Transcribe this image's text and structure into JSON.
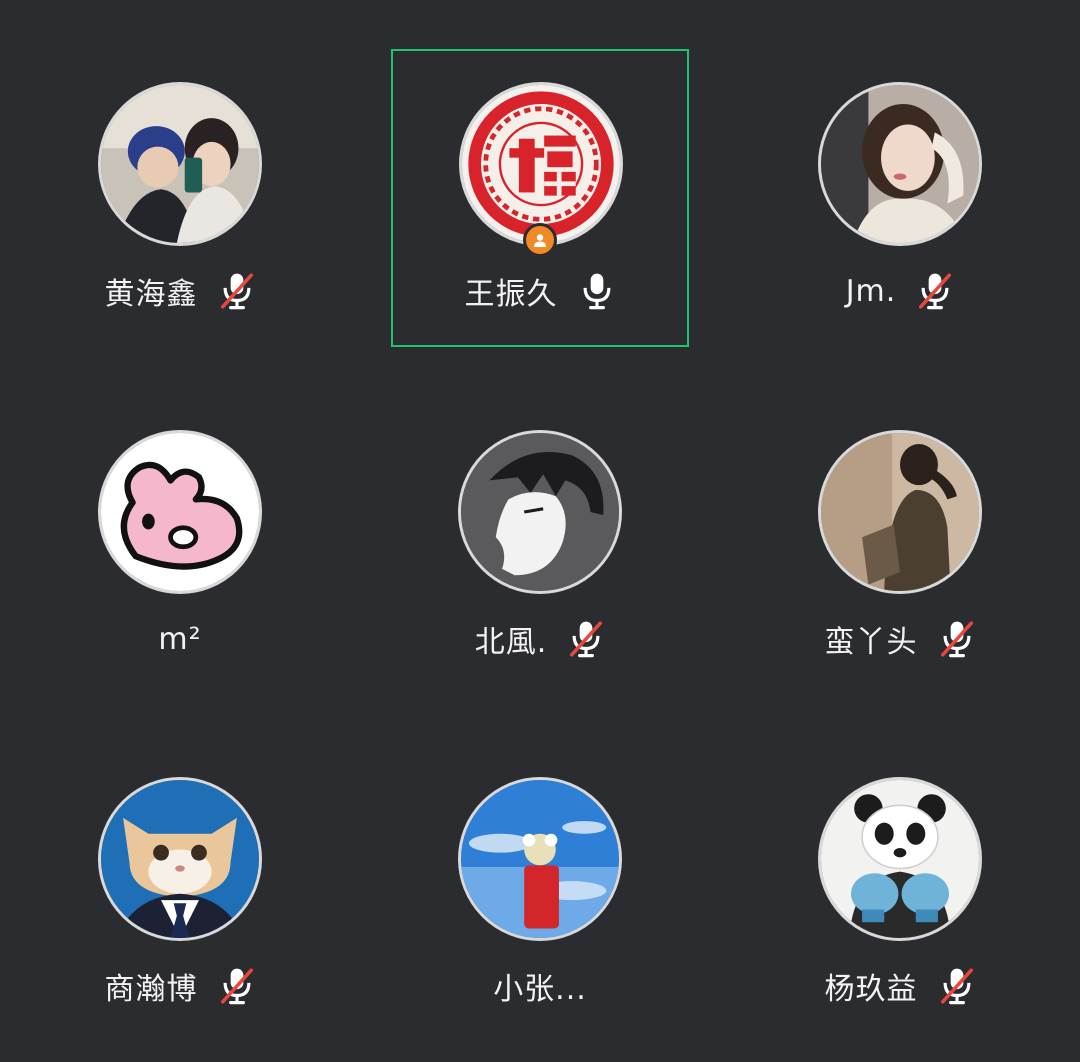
{
  "participants": [
    {
      "name": "黄海鑫",
      "mic": "muted"
    },
    {
      "name": "王振久",
      "mic": "on",
      "speaking": true,
      "host": true
    },
    {
      "name": "Jm.",
      "mic": "muted"
    },
    {
      "name": "m²",
      "mic": "none"
    },
    {
      "name": "北風.",
      "mic": "muted"
    },
    {
      "name": "蛮丫头",
      "mic": "muted"
    },
    {
      "name": "商瀚博",
      "mic": "muted"
    },
    {
      "name": "小张...",
      "mic": "none"
    },
    {
      "name": "杨玖益",
      "mic": "muted"
    }
  ],
  "icons": {
    "mic_on": "microphone-icon",
    "mic_muted": "microphone-muted-icon",
    "host_badge": "host-badge-icon"
  },
  "colors": {
    "background": "#2b2c30",
    "speaking_border": "#1fc36a",
    "muted_slash": "#e8473c",
    "host_badge": "#f08a24"
  }
}
